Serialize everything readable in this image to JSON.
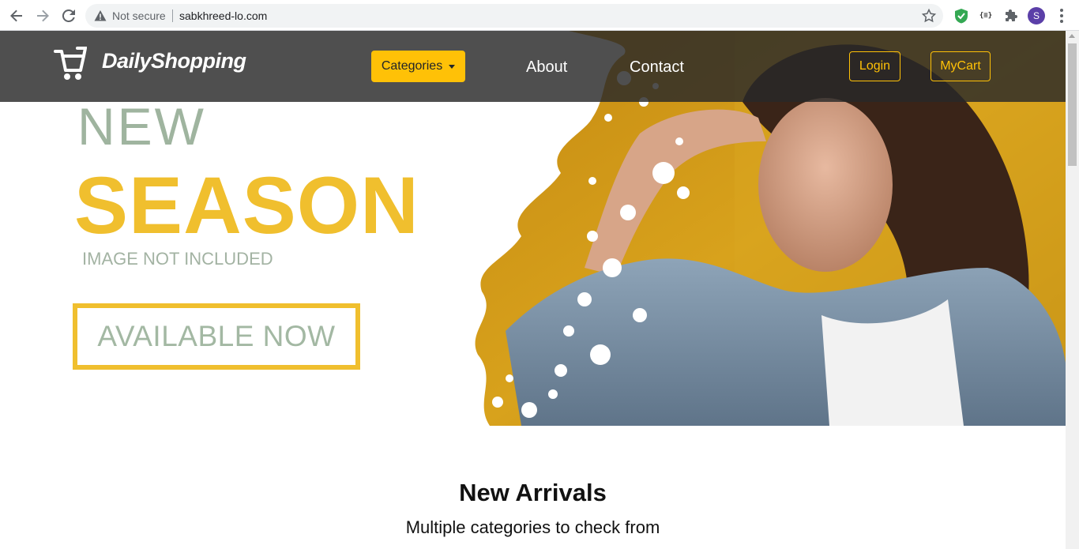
{
  "browser": {
    "security_label": "Not secure",
    "url": "sabkhreed-lo.com",
    "profile_initial": "S",
    "json_ext_label": "{≡}"
  },
  "navbar": {
    "brand": "DailyShopping",
    "categories_label": "Categories",
    "about_label": "About",
    "contact_label": "Contact",
    "login_label": "Login",
    "cart_label": "MyCart"
  },
  "hero": {
    "line1": "NEW",
    "line2": "SEASON",
    "line3": "IMAGE NOT INCLUDED",
    "cta": "AVAILABLE NOW"
  },
  "section": {
    "title": "New Arrivals",
    "subtitle": "Multiple categories to check from"
  },
  "colors": {
    "accent": "#ffc107",
    "season_yellow": "#f0bf2e",
    "sage": "#9fb49f",
    "navbar": "#2f2f2f"
  }
}
